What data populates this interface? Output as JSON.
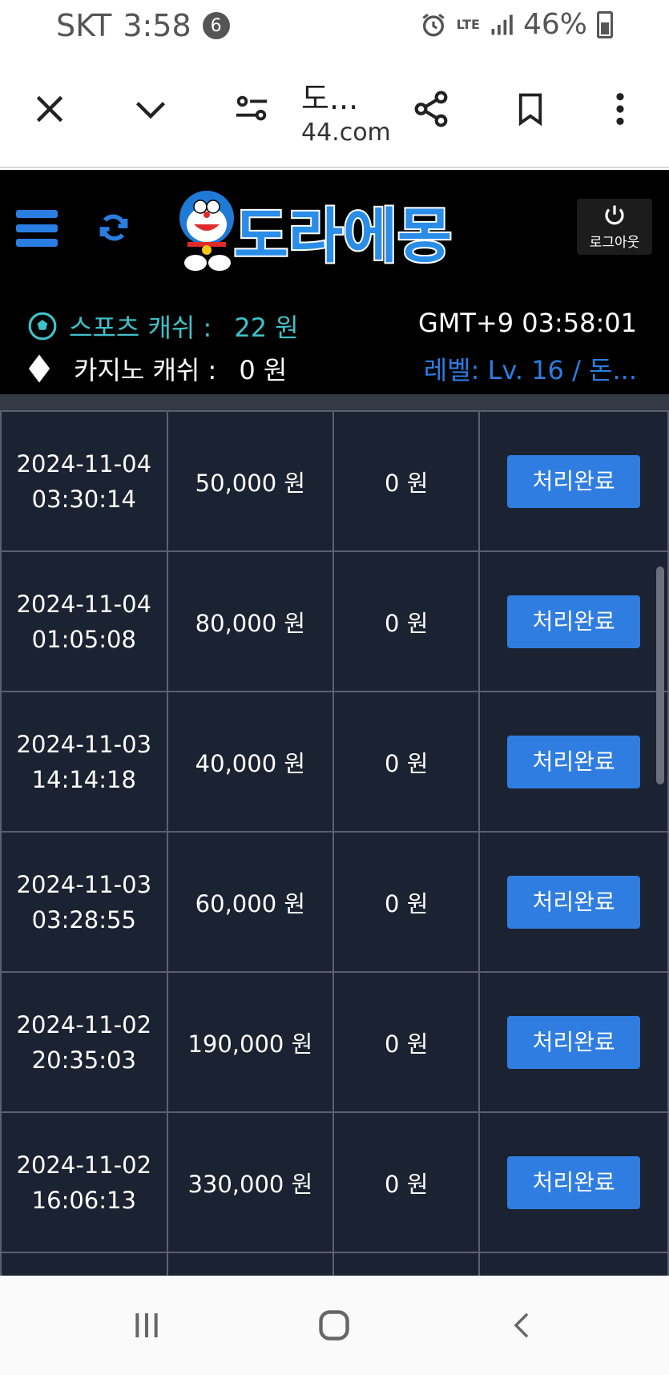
{
  "status_bar": {
    "carrier": "SKT",
    "time": "3:58",
    "notification_count": "6",
    "network": "LTE",
    "battery": "46%"
  },
  "browser": {
    "page_title": "도...",
    "domain": "44.com",
    "icons": [
      "close-icon",
      "chevron-down-icon",
      "tune-icon",
      "share-icon",
      "bookmark-icon",
      "more-vert-icon"
    ]
  },
  "site_header": {
    "logo_text": "도라에몽",
    "logout_label": "로그아웃",
    "sports_cash_label": "스포츠 캐쉬 :",
    "sports_cash_value": "22 원",
    "casino_cash_label": "카지노 캐쉬 :",
    "casino_cash_value": "0 원",
    "clock": "GMT+9 03:58:01",
    "level": "레벨: Lv. 16 / 돈...",
    "colors": {
      "accent_blue": "#2a7de1",
      "teal": "#3fc1c9"
    }
  },
  "records": [
    {
      "date": "2024-11-04",
      "time": "03:30:14",
      "amount": "50,000 원",
      "bonus": "0 원",
      "status": "처리완료"
    },
    {
      "date": "2024-11-04",
      "time": "01:05:08",
      "amount": "80,000 원",
      "bonus": "0 원",
      "status": "처리완료"
    },
    {
      "date": "2024-11-03",
      "time": "14:14:18",
      "amount": "40,000 원",
      "bonus": "0 원",
      "status": "처리완료"
    },
    {
      "date": "2024-11-03",
      "time": "03:28:55",
      "amount": "60,000 원",
      "bonus": "0 원",
      "status": "처리완료"
    },
    {
      "date": "2024-11-02",
      "time": "20:35:03",
      "amount": "190,000 원",
      "bonus": "0 원",
      "status": "처리완료"
    },
    {
      "date": "2024-11-02",
      "time": "16:06:13",
      "amount": "330,000 원",
      "bonus": "0 원",
      "status": "처리완료"
    }
  ],
  "nav": {
    "icons": [
      "recent-apps-icon",
      "home-icon",
      "back-icon"
    ]
  }
}
